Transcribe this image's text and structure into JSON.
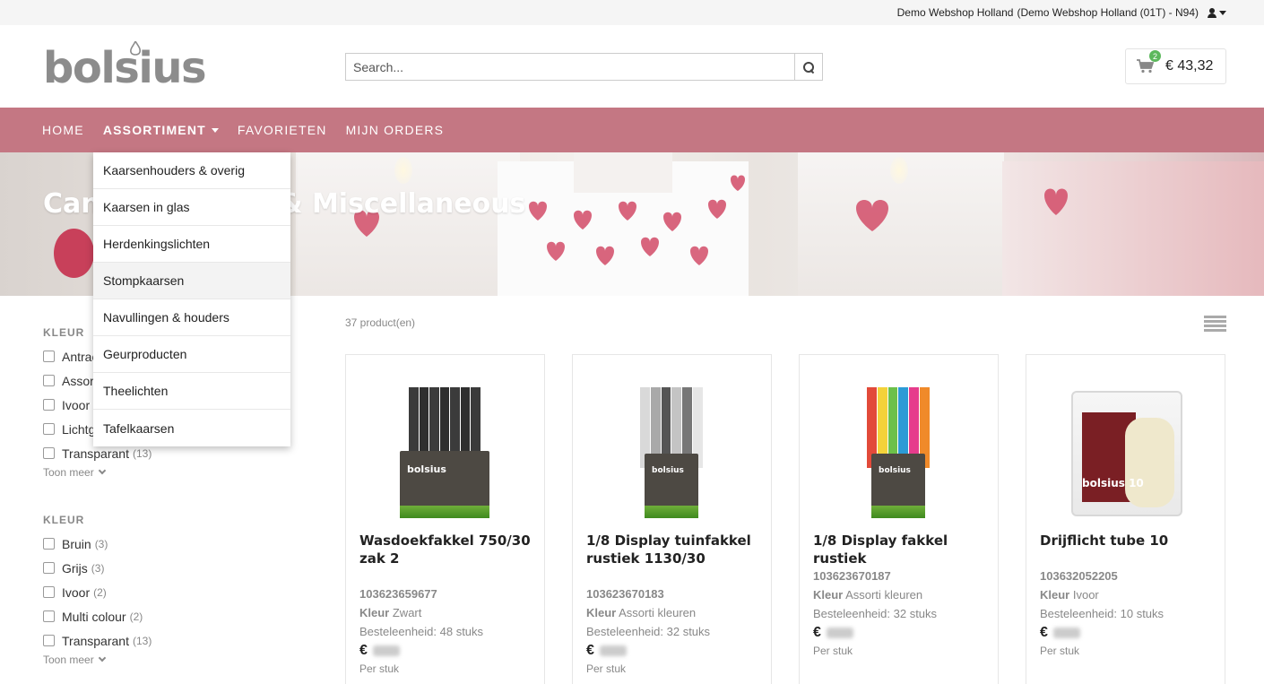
{
  "topbar": {
    "shop": "Demo Webshop Holland",
    "account": "(Demo Webshop Holland (01T) - N94)"
  },
  "header": {
    "logo": "bolsius",
    "search_placeholder": "Search...",
    "cart_count": "2",
    "cart_total": "€ 43,32"
  },
  "nav": {
    "items": [
      "HOME",
      "ASSORTIMENT",
      "FAVORIETEN",
      "MIJN ORDERS"
    ]
  },
  "banner": {
    "title": "Candle holders & Miscellaneous"
  },
  "dropdown": {
    "items": [
      "Kaarsenhouders & overig",
      "Kaarsen in glas",
      "Herdenkingslichten",
      "Stompkaarsen",
      "Navullingen & houders",
      "Geurproducten",
      "Theelichten",
      "Tafelkaarsen"
    ]
  },
  "filters": [
    {
      "title": "KLEUR",
      "options": [
        {
          "label": "Antraciet",
          "count": ""
        },
        {
          "label": "Assorti kleuren",
          "count": ""
        },
        {
          "label": "Ivoor",
          "count": ""
        },
        {
          "label": "Lichtgrijs",
          "count": ""
        },
        {
          "label": "Transparant",
          "count": "(13)"
        }
      ],
      "more": "Toon meer"
    },
    {
      "title": "KLEUR",
      "options": [
        {
          "label": "Bruin",
          "count": "(3)"
        },
        {
          "label": "Grijs",
          "count": "(3)"
        },
        {
          "label": "Ivoor",
          "count": "(2)"
        },
        {
          "label": "Multi colour",
          "count": "(2)"
        },
        {
          "label": "Transparant",
          "count": "(13)"
        }
      ],
      "more": "Toon meer"
    }
  ],
  "products_count": "37 product(en)",
  "products": [
    {
      "name": "Wasdoekfakkel 750/30 zak 2",
      "sku": "103623659677",
      "kleur_label": "Kleur",
      "kleur": "Zwart",
      "unit": "Besteleenheid: 48 stuks",
      "currency": "€",
      "per": "Per stuk"
    },
    {
      "name": "1/8 Display tuinfakkel rustiek 1130/30",
      "sku": "103623670183",
      "kleur_label": "Kleur",
      "kleur": "Assorti kleuren",
      "unit": "Besteleenheid: 32 stuks",
      "currency": "€",
      "per": "Per stuk"
    },
    {
      "name": "1/8 Display fakkel rustiek",
      "sku": "103623670187",
      "kleur_label": "Kleur",
      "kleur": "Assorti kleuren",
      "unit": "Besteleenheid: 32 stuks",
      "currency": "€",
      "per": "Per stuk"
    },
    {
      "name": "Drijflicht tube 10",
      "sku": "103632052205",
      "kleur_label": "Kleur",
      "kleur": "Ivoor",
      "unit": "Besteleenheid: 10 stuks",
      "currency": "€",
      "per": "Per stuk"
    }
  ],
  "colors": {
    "nav": "#c47783",
    "badge": "#5cb85c"
  }
}
